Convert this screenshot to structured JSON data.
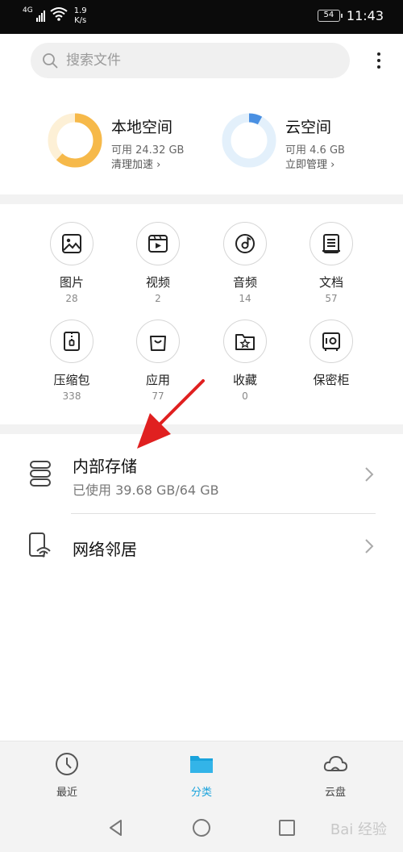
{
  "status_bar": {
    "signal_label": "4G",
    "speed_value": "1.9",
    "speed_unit": "K/s",
    "battery": "54",
    "time": "11:43"
  },
  "search": {
    "placeholder": "搜索文件"
  },
  "storage": {
    "local": {
      "title": "本地空间",
      "available": "可用 24.32 GB",
      "action": "清理加速 ›",
      "used_fraction": 0.62,
      "color": "#f6b94a"
    },
    "cloud": {
      "title": "云空间",
      "available": "可用 4.6 GB",
      "action": "立即管理 ›",
      "used_fraction": 0.08,
      "color": "#4a90e2"
    }
  },
  "categories": [
    {
      "label": "图片",
      "count": "28",
      "icon": "image-icon"
    },
    {
      "label": "视频",
      "count": "2",
      "icon": "video-icon"
    },
    {
      "label": "音频",
      "count": "14",
      "icon": "audio-icon"
    },
    {
      "label": "文档",
      "count": "57",
      "icon": "document-icon"
    },
    {
      "label": "压缩包",
      "count": "338",
      "icon": "archive-icon"
    },
    {
      "label": "应用",
      "count": "77",
      "icon": "app-icon"
    },
    {
      "label": "收藏",
      "count": "0",
      "icon": "favorite-icon"
    },
    {
      "label": "保密柜",
      "count": "",
      "icon": "safe-icon"
    }
  ],
  "locations": [
    {
      "title": "内部存储",
      "subtitle": "已使用 39.68 GB/64 GB",
      "icon": "storage-icon"
    },
    {
      "title": "网络邻居",
      "subtitle": "",
      "icon": "network-icon"
    }
  ],
  "bottom_nav": [
    {
      "label": "最近",
      "icon": "clock-icon",
      "active": false
    },
    {
      "label": "分类",
      "icon": "folder-icon",
      "active": true
    },
    {
      "label": "云盘",
      "icon": "cloud-icon",
      "active": false
    }
  ],
  "accent_color": "#1aa3dc",
  "annotation_color": "#e02020",
  "watermark": "Bai 经验"
}
